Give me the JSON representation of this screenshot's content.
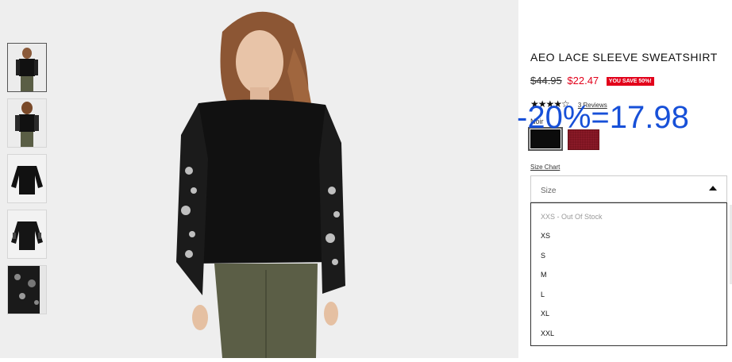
{
  "product": {
    "title": "AEO LACE SLEEVE SWEATSHIRT",
    "old_price": "$44.95",
    "new_price": "$22.47",
    "save_badge": "YOU SAVE 50%!",
    "rating_stars": "★★★★☆",
    "rating": 4,
    "reviews_link": "3 Reviews",
    "color_label": "Noir",
    "size_chart_link": "Size Chart"
  },
  "size_select": {
    "label": "Size",
    "options": [
      "XXS - Out Of Stock",
      "XS",
      "S",
      "M",
      "L",
      "XL",
      "XXL"
    ]
  },
  "annotation": {
    "text": "-20%=17.98",
    "color": "#1750d8"
  },
  "colors": {
    "price_red": "#e2001a",
    "swatch_black": "#0c0c0c",
    "swatch_red": "#7c1420"
  },
  "thumbnails": [
    "front-view",
    "back-view",
    "flat-front",
    "flat-back",
    "lace-detail"
  ]
}
